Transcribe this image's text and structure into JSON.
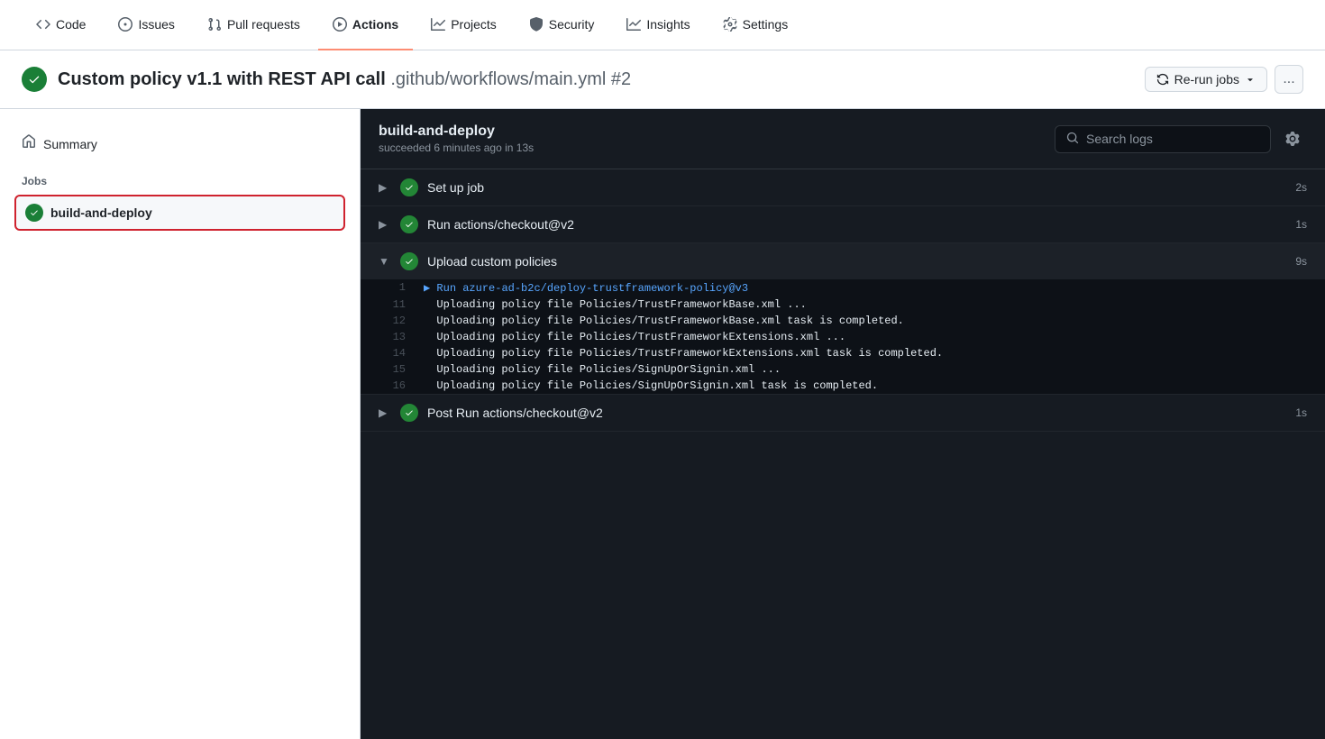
{
  "nav": {
    "items": [
      {
        "id": "code",
        "label": "Code",
        "icon": "code-icon",
        "active": false
      },
      {
        "id": "issues",
        "label": "Issues",
        "icon": "issues-icon",
        "active": false
      },
      {
        "id": "pull-requests",
        "label": "Pull requests",
        "icon": "pull-requests-icon",
        "active": false
      },
      {
        "id": "actions",
        "label": "Actions",
        "icon": "actions-icon",
        "active": true
      },
      {
        "id": "projects",
        "label": "Projects",
        "icon": "projects-icon",
        "active": false
      },
      {
        "id": "security",
        "label": "Security",
        "icon": "security-icon",
        "active": false
      },
      {
        "id": "insights",
        "label": "Insights",
        "icon": "insights-icon",
        "active": false
      },
      {
        "id": "settings",
        "label": "Settings",
        "icon": "settings-icon",
        "active": false
      }
    ]
  },
  "header": {
    "title": "Custom policy v1.1 with REST API call",
    "path": ".github/workflows/main.yml #2",
    "rerun_label": "Re-run jobs",
    "dots_label": "..."
  },
  "sidebar": {
    "summary_label": "Summary",
    "jobs_section_label": "Jobs",
    "jobs": [
      {
        "id": "build-and-deploy",
        "label": "build-and-deploy",
        "status": "success",
        "active": true
      }
    ]
  },
  "log_panel": {
    "job_name": "build-and-deploy",
    "job_subtitle": "succeeded 6 minutes ago in 13s",
    "search_placeholder": "Search logs",
    "steps": [
      {
        "id": "setup-job",
        "label": "Set up job",
        "duration": "2s",
        "status": "success",
        "expanded": false,
        "chevron": "▶"
      },
      {
        "id": "checkout",
        "label": "Run actions/checkout@v2",
        "duration": "1s",
        "status": "success",
        "expanded": false,
        "chevron": "▶"
      },
      {
        "id": "upload-policies",
        "label": "Upload custom policies",
        "duration": "9s",
        "status": "success",
        "expanded": true,
        "chevron": "▼"
      },
      {
        "id": "post-checkout",
        "label": "Post Run actions/checkout@v2",
        "duration": "1s",
        "status": "success",
        "expanded": false,
        "chevron": "▶"
      }
    ],
    "log_lines": [
      {
        "num": "1",
        "text": "▶ Run azure-ad-b2c/deploy-trustframework-policy@v3",
        "type": "run-marker"
      },
      {
        "num": "11",
        "text": "  Uploading policy file Policies/TrustFrameworkBase.xml ...",
        "type": "normal"
      },
      {
        "num": "12",
        "text": "  Uploading policy file Policies/TrustFrameworkBase.xml task is completed.",
        "type": "normal"
      },
      {
        "num": "13",
        "text": "  Uploading policy file Policies/TrustFrameworkExtensions.xml ...",
        "type": "normal"
      },
      {
        "num": "14",
        "text": "  Uploading policy file Policies/TrustFrameworkExtensions.xml task is completed.",
        "type": "normal"
      },
      {
        "num": "15",
        "text": "  Uploading policy file Policies/SignUpOrSignin.xml ...",
        "type": "normal"
      },
      {
        "num": "16",
        "text": "  Uploading policy file Policies/SignUpOrSignin.xml task is completed.",
        "type": "normal"
      }
    ]
  }
}
